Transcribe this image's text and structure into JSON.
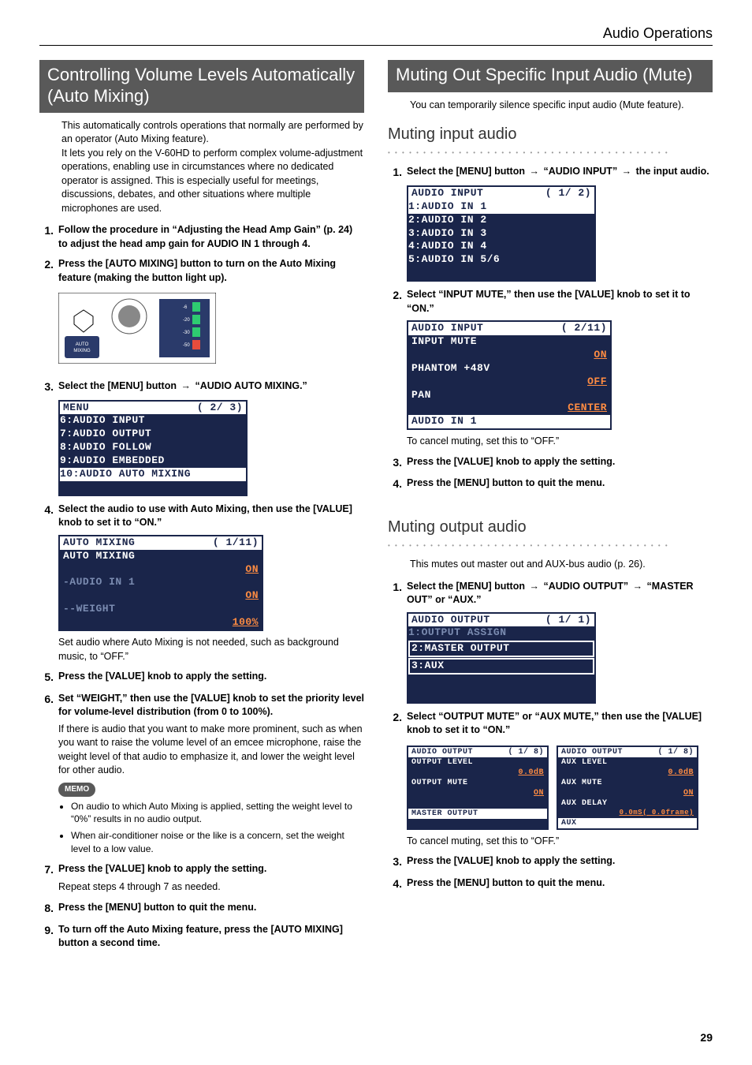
{
  "header": {
    "section": "Audio Operations"
  },
  "page_number": "29",
  "left": {
    "title": "Controlling Volume Levels Automatically (Auto Mixing)",
    "intro": "This automatically controls operations that normally are performed by an operator (Auto Mixing feature).\nIt lets you rely on the V-60HD to perform complex volume-adjustment operations, enabling use in circumstances where no dedicated operator is assigned. This is especially useful for meetings, discussions, debates, and other situations where multiple microphones are used.",
    "steps": {
      "s1": "Follow the procedure in “Adjusting the Head Amp Gain” (p. 24) to adjust the head amp gain for AUDIO IN 1 through 4.",
      "s2": "Press the [AUTO MIXING] button to turn on the Auto Mixing feature (making the button light up).",
      "s3_pre": "Select the [MENU] button ",
      "s3_post": " “AUDIO AUTO MIXING.”",
      "s4": "Select the audio to use with Auto Mixing, then use the [VALUE] knob to set it to “ON.”",
      "s4_note": "Set audio where Auto Mixing is not needed, such as background music, to “OFF.”",
      "s5": "Press the [VALUE] knob to apply the setting.",
      "s6": "Set “WEIGHT,” then use the [VALUE] knob to set the priority level for volume-level distribution (from 0 to 100%).",
      "s6_note": "If there is audio that you want to make more prominent, such as when you want to raise the volume level of an emcee microphone, raise the weight level of that audio to emphasize it, and lower the weight level for other audio.",
      "memo_label": "MEMO",
      "memo1": "On audio to which Auto Mixing is applied, setting the weight level to “0%” results in no audio output.",
      "memo2": "When air-conditioner noise or the like is a concern, set the weight level to a low value.",
      "s7": "Press the [VALUE] knob to apply the setting.",
      "s7_note": "Repeat steps 4 through 7 as needed.",
      "s8": "Press the [MENU] button to quit the menu.",
      "s9": "To turn off the Auto Mixing feature, press the [AUTO MIXING] button a second time."
    },
    "lcd_menu": {
      "head_l": "MENU",
      "head_r": "( 2/ 3)",
      "rows": [
        "6:AUDIO INPUT",
        "7:AUDIO OUTPUT",
        "8:AUDIO FOLLOW",
        "9:AUDIO EMBEDDED",
        "10:AUDIO AUTO MIXING"
      ]
    },
    "lcd_mix": {
      "head_l": "AUTO MIXING",
      "head_r": "( 1/11)",
      "r1": "AUTO MIXING",
      "r1v": "ON",
      "r2": "-AUDIO IN 1",
      "r2v": "ON",
      "r3": "--WEIGHT",
      "r3v": "100%"
    }
  },
  "right": {
    "title": "Muting Out Specific Input Audio (Mute)",
    "intro": "You can temporarily silence specific input audio (Mute feature).",
    "sect1": {
      "heading": "Muting input audio",
      "s1_pre": "Select the [MENU] button ",
      "s1_mid": " “AUDIO INPUT” ",
      "s1_post": " the input audio.",
      "s2": "Select “INPUT MUTE,” then use the [VALUE] knob to set it to “ON.”",
      "s2_note": "To cancel muting, set this to “OFF.”",
      "s3": "Press the [VALUE] knob to apply the setting.",
      "s4": "Press the [MENU] button to quit the menu."
    },
    "lcd_in": {
      "head_l": "AUDIO INPUT",
      "head_r": "( 1/ 2)",
      "rows": [
        "1:AUDIO IN 1",
        "2:AUDIO IN 2",
        "3:AUDIO IN 3",
        "4:AUDIO IN 4",
        "5:AUDIO IN 5/6"
      ]
    },
    "lcd_mute": {
      "head_l": "AUDIO INPUT",
      "head_r": "( 2/11)",
      "r1": "INPUT MUTE",
      "r1v": "ON",
      "r2": "PHANTOM +48V",
      "r2v": "OFF",
      "r3": "PAN",
      "r3v": "CENTER",
      "foot": "AUDIO IN 1"
    },
    "sect2": {
      "heading": "Muting output audio",
      "intro": "This mutes out master out and AUX-bus audio (p. 26).",
      "s1_pre": "Select the [MENU] button ",
      "s1_mid": " “AUDIO OUTPUT” ",
      "s1_post": " “MASTER OUT” or “AUX.”",
      "s2": "Select “OUTPUT MUTE” or “AUX MUTE,” then use the [VALUE] knob to set it to “ON.”",
      "s2_note": "To cancel muting, set this to “OFF.”",
      "s3": "Press the [VALUE] knob to apply the setting.",
      "s4": "Press the [MENU] button to quit the menu."
    },
    "lcd_out": {
      "head_l": "AUDIO OUTPUT",
      "head_r": "( 1/ 1)",
      "rows": [
        "1:OUTPUT ASSIGN",
        "2:MASTER OUTPUT",
        "3:AUX"
      ]
    },
    "lcd_pair_a": {
      "head_l": "AUDIO OUTPUT",
      "head_r": "( 1/ 8)",
      "r1": "OUTPUT LEVEL",
      "r1v": "0.0dB",
      "r2": "OUTPUT MUTE",
      "r2v": "ON",
      "foot": "MASTER OUTPUT"
    },
    "lcd_pair_b": {
      "head_l": "AUDIO OUTPUT",
      "head_r": "( 1/ 8)",
      "r1": "AUX LEVEL",
      "r1v": "0.0dB",
      "r2": "AUX MUTE",
      "r2v": "ON",
      "r3": "AUX DELAY",
      "r3v": "0.0mS( 0.0frame)",
      "foot": "AUX"
    }
  }
}
